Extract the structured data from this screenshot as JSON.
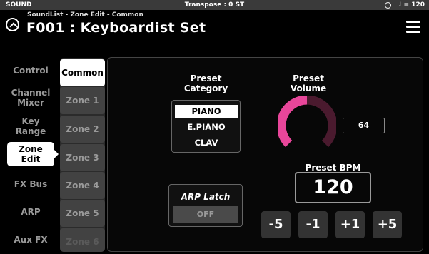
{
  "status_bar": {
    "left": "SOUND",
    "center": "Transpose : 0 ST",
    "tempo": "♩ = 120"
  },
  "header": {
    "breadcrumb": "SoundList - Zone Edit - Common",
    "title": "F001 : Keyboardist Set"
  },
  "left_nav": {
    "items": [
      {
        "label": "Control"
      },
      {
        "label": "Channel\nMixer"
      },
      {
        "label": "Key\nRange"
      },
      {
        "label": "Zone\nEdit",
        "active": true
      },
      {
        "label": "FX Bus"
      },
      {
        "label": "ARP"
      },
      {
        "label": "Aux FX"
      }
    ]
  },
  "zones": {
    "items": [
      {
        "label": "Common",
        "active": true
      },
      {
        "label": "Zone 1"
      },
      {
        "label": "Zone 2"
      },
      {
        "label": "Zone 3"
      },
      {
        "label": "Zone 4"
      },
      {
        "label": "Zone 5"
      },
      {
        "label": "Zone 6"
      }
    ]
  },
  "preset_category": {
    "label": "Preset\nCategory",
    "options": [
      "PIANO",
      "E.PIANO",
      "CLAV"
    ],
    "selected": "PIANO"
  },
  "preset_volume": {
    "label": "Preset\nVolume",
    "value": "64",
    "level": 0.5
  },
  "arp_latch": {
    "label": "ARP Latch",
    "value": "OFF"
  },
  "preset_bpm": {
    "label": "Preset BPM",
    "value": "120",
    "steps": [
      "-5",
      "-1",
      "+1",
      "+5"
    ]
  },
  "colors": {
    "accent": "#e8469a",
    "knob_track": "#4a1a2e",
    "status_bar": "#3a3a3a"
  }
}
